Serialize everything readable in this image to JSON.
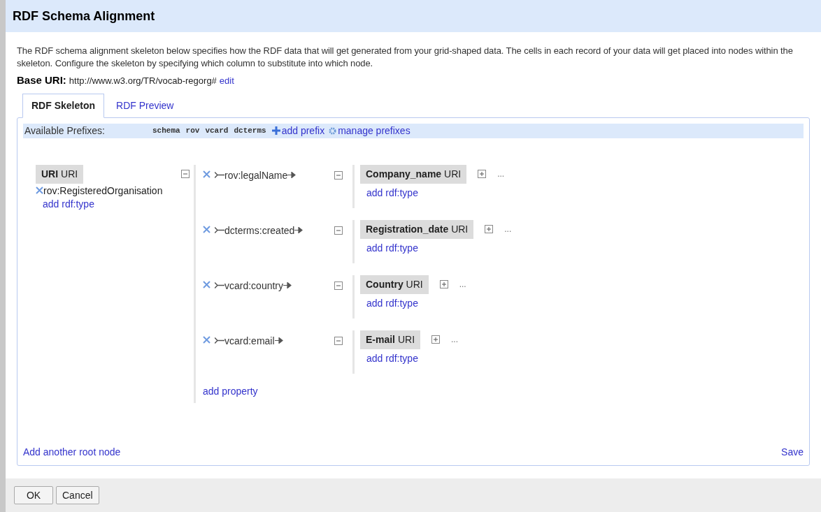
{
  "dialog": {
    "title": "RDF Schema Alignment"
  },
  "description": "The RDF schema alignment skeleton below specifies how the RDF data that will get generated from your grid-shaped data. The cells in each record of your data will get placed into nodes within the skeleton. Configure the skeleton by specifying which column to substitute into which node.",
  "base_uri": {
    "label": "Base URI:",
    "value": "http://www.w3.org/TR/vocab-regorg#",
    "edit": "edit"
  },
  "tabs": [
    {
      "label": "RDF Skeleton",
      "selected": true
    },
    {
      "label": "RDF Preview",
      "selected": false
    }
  ],
  "prefixes": {
    "label": "Available Prefixes:",
    "items": [
      "schema",
      "rov",
      "vcard",
      "dcterms"
    ],
    "add": "add prefix",
    "manage": "manage prefixes"
  },
  "root_node": {
    "name": "URI",
    "type": "URI",
    "rdf_types": [
      "rov:RegisteredOrganisation"
    ],
    "add_type": "add rdf:type",
    "properties": [
      {
        "name": "rov:legalName",
        "target": {
          "name": "Company_name",
          "type": "URI",
          "add_type": "add rdf:type",
          "more": "..."
        }
      },
      {
        "name": "dcterms:created",
        "target": {
          "name": "Registration_date",
          "type": "URI",
          "add_type": "add rdf:type",
          "more": "..."
        }
      },
      {
        "name": "vcard:country",
        "target": {
          "name": "Country",
          "type": "URI",
          "add_type": "add rdf:type",
          "more": "..."
        }
      },
      {
        "name": "vcard:email",
        "target": {
          "name": "E-mail",
          "type": "URI",
          "add_type": "add rdf:type",
          "more": "..."
        }
      }
    ],
    "add_property": "add property"
  },
  "add_root": "Add another root node",
  "save": "Save",
  "buttons": [
    "OK",
    "Cancel"
  ]
}
